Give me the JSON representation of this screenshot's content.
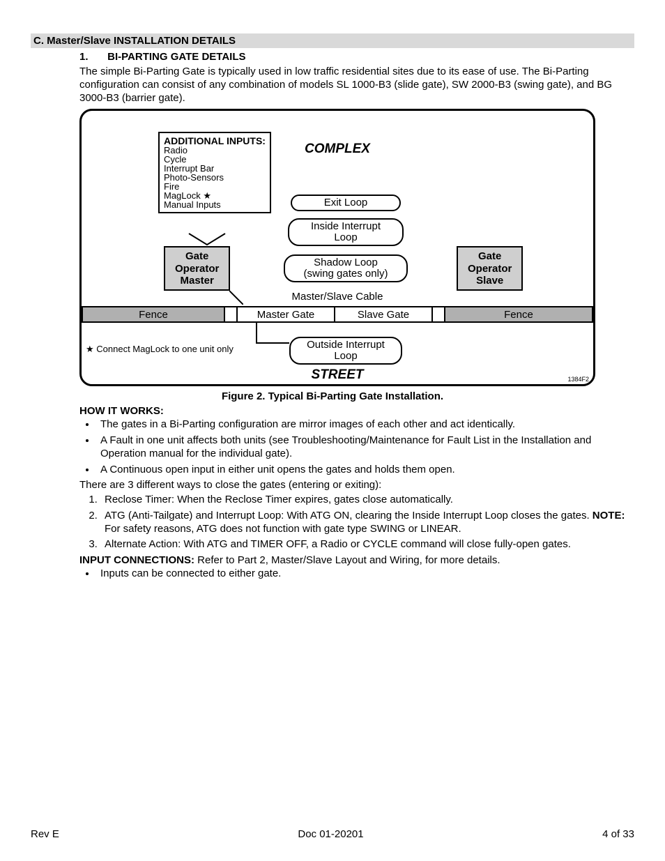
{
  "section": {
    "letter": "C.",
    "title": "Master/Slave INSTALLATION DETAILS",
    "full": "C.  Master/Slave INSTALLATION DETAILS"
  },
  "sub": {
    "number": "1.",
    "title": "BI-PARTING GATE DETAILS"
  },
  "intro": "The simple Bi-Parting Gate is typically used in low traffic residential sites due to its ease of use.  The Bi-Parting configuration can consist of any combination of models SL 1000-B3 (slide gate), SW 2000-B3 (swing gate), and BG 3000-B3 (barrier gate).",
  "figure": {
    "inputs_title": "ADDITIONAL INPUTS:",
    "inputs": [
      "Radio",
      "Cycle",
      "Interrupt Bar",
      "Photo-Sensors",
      "Fire",
      "MagLock ★",
      "Manual Inputs"
    ],
    "gate_op_master": "Gate Operator Master",
    "gate_op_slave": "Gate Operator Slave",
    "complex": "COMPLEX",
    "exit_loop": "Exit Loop",
    "inside_loop": "Inside Interrupt Loop",
    "shadow_loop": "Shadow Loop (swing gates only)",
    "cable": "Master/Slave Cable",
    "fence": "Fence",
    "master_gate": "Master Gate",
    "slave_gate": "Slave Gate",
    "outside_loop": "Outside Interrupt Loop",
    "maglock_note": "★ Connect MagLock to one unit only",
    "street": "STREET",
    "code": "1384F2",
    "caption": "Figure 2.  Typical Bi-Parting Gate Installation."
  },
  "hiw": {
    "heading": "HOW IT WORKS:",
    "bullets": [
      "The gates in a Bi-Parting configuration are mirror images of each other and act identically.",
      "A Fault in one unit affects both units (see Troubleshooting/Maintenance for Fault List in the Installation and Operation manual for the individual gate).",
      "A Continuous open input in either unit opens the gates and holds them open."
    ],
    "ways_intro": "There are 3 different ways to close the gates (entering or exiting):",
    "ways": [
      "Reclose Timer:  When the Reclose Timer expires, gates close automatically.",
      "ATG (Anti-Tailgate) and Interrupt Loop:  With ATG ON, clearing the Inside Interrupt Loop closes the gates.  NOTE:  For safety reasons, ATG does not function with gate type SWING or LINEAR.",
      "Alternate Action:  With ATG and TIMER OFF, a Radio or CYCLE command will close fully-open gates."
    ],
    "inputconn_label": "INPUT CONNECTIONS:",
    "inputconn_text": "  Refer to Part 2, Master/Slave Layout and Wiring, for more details.",
    "inputconn_bullet": "Inputs can be connected to either gate."
  },
  "footer": {
    "rev": "Rev E",
    "doc": "Doc 01-20201",
    "page": "4 of 33"
  }
}
